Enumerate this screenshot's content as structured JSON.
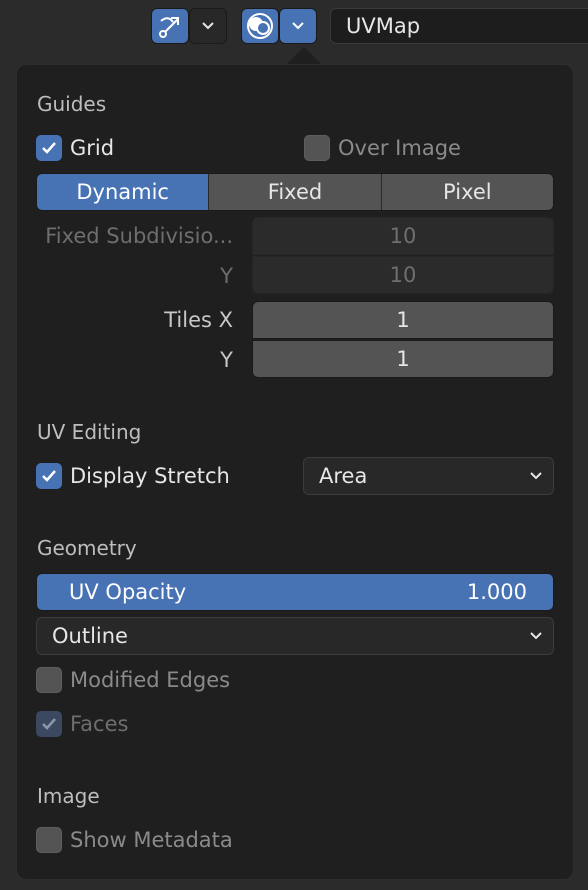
{
  "header": {
    "uv_map_name": "UVMap"
  },
  "guides": {
    "title": "Guides",
    "grid_label": "Grid",
    "grid_checked": true,
    "over_image_label": "Over Image",
    "over_image_checked": false,
    "grid_modes": [
      "Dynamic",
      "Fixed",
      "Pixel"
    ],
    "grid_mode_selected": "Dynamic",
    "fixed_subdivisions_label": "Fixed Subdivisio...",
    "fixed_subdivisions_x": "10",
    "fixed_subdivisions_y_label": "Y",
    "fixed_subdivisions_y": "10",
    "tiles_x_label": "Tiles X",
    "tiles_x": "1",
    "tiles_y_label": "Y",
    "tiles_y": "1"
  },
  "uv_editing": {
    "title": "UV Editing",
    "display_stretch_label": "Display Stretch",
    "display_stretch_checked": true,
    "stretch_type": "Area"
  },
  "geometry": {
    "title": "Geometry",
    "uv_opacity_label": "UV Opacity",
    "uv_opacity_value": "1.000",
    "edge_display": "Outline",
    "modified_edges_label": "Modified Edges",
    "modified_edges_checked": false,
    "faces_label": "Faces",
    "faces_checked": true
  },
  "image": {
    "title": "Image",
    "show_metadata_label": "Show Metadata",
    "show_metadata_checked": false
  },
  "colors": {
    "accent": "#4772b3",
    "panel": "#1f1f1f",
    "widget": "#545454"
  }
}
